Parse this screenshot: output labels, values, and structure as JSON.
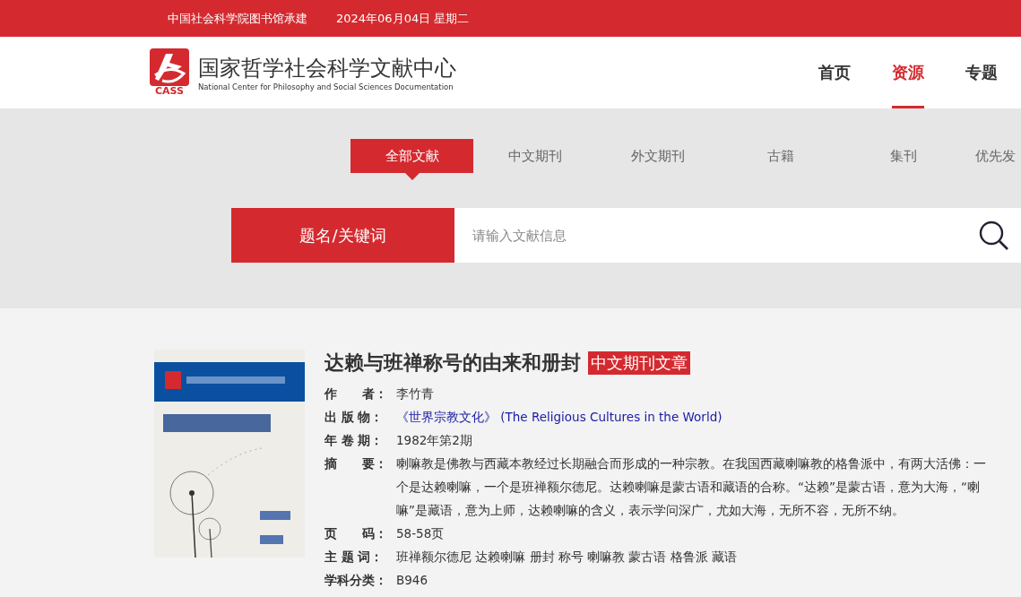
{
  "top_bar": {
    "builder": "中国社会科学院图书馆承建",
    "date": "2024年06月04日 星期二"
  },
  "header": {
    "logo_mark": "CASS",
    "title": "国家哲学社会科学文献中心",
    "subtitle": "National Center for Philosophy and Social Sciences Documentation",
    "nav": [
      {
        "label": "首页",
        "selected": false
      },
      {
        "label": "资源",
        "selected": true
      },
      {
        "label": "专题",
        "selected": false
      }
    ]
  },
  "category_tabs": [
    {
      "label": "全部文献",
      "selected": true
    },
    {
      "label": "中文期刊",
      "selected": false
    },
    {
      "label": "外文期刊",
      "selected": false
    },
    {
      "label": "古籍",
      "selected": false
    },
    {
      "label": "集刊",
      "selected": false
    },
    {
      "label": "优先发",
      "selected": false
    }
  ],
  "search": {
    "field_type": "题名/关键词",
    "placeholder": "请输入文献信息"
  },
  "article": {
    "title": "达赖与班禅称号的由来和册封",
    "badge": "中文期刊文章",
    "fields": [
      {
        "kind": "text",
        "label": "作　　者：",
        "value": "李竹青"
      },
      {
        "kind": "link",
        "label": "出 版 物：",
        "value": "《世界宗教文化》 (The Religious Cultures in the World)"
      },
      {
        "kind": "text",
        "label": "年 卷 期：",
        "value": "1982年第2期"
      },
      {
        "kind": "text",
        "label": "摘　　要：",
        "value": "喇嘛教是佛教与西藏本教经过长期融合而形成的一种宗教。在我国西藏喇嘛教的格鲁派中，有两大活佛：一个是达赖喇嘛，一个是班禅额尔德尼。达赖喇嘛是蒙古语和藏语的合称。“达赖”是蒙古语，意为大海，“喇嘛”是藏语，意为上师，达赖喇嘛的含义，表示学问深广，尤如大海，无所不容，无所不纳。"
      },
      {
        "kind": "text",
        "label": "页　　码：",
        "value": "58-58页"
      },
      {
        "kind": "text",
        "label": "主 题 词：",
        "value": "班禅额尔德尼 达赖喇嘛 册封 称号 喇嘛教 蒙古语 格鲁派 藏语"
      },
      {
        "kind": "text",
        "label": "学科分类：",
        "value": "B946"
      }
    ]
  }
}
